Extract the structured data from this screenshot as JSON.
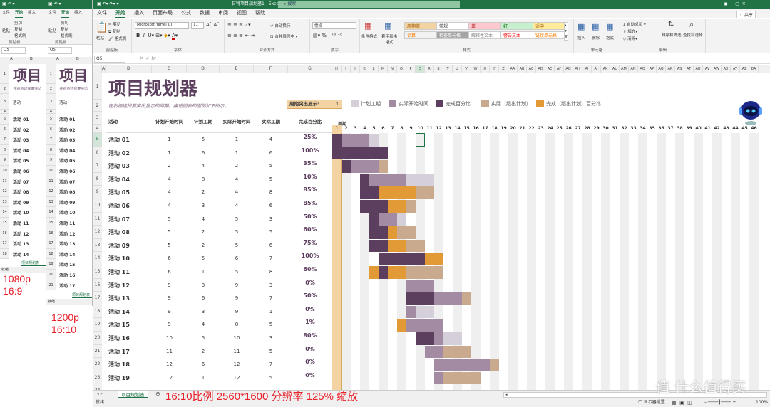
{
  "window": {
    "title": "甘特项目规划器1 - Excel",
    "search": "搜索",
    "share": "共享"
  },
  "tabs": [
    "文件",
    "开始",
    "插入",
    "页面布局",
    "公式",
    "数据",
    "审阅",
    "视图",
    "帮助"
  ],
  "active_tab": "开始",
  "ribbon": {
    "clipboard": {
      "paste": "粘贴",
      "cut": "剪切",
      "copy": "复制",
      "format_painter": "格式刷",
      "label": "剪贴板"
    },
    "font": {
      "name": "Microsoft YaHei UI",
      "size": "11",
      "label": "字体"
    },
    "alignment": {
      "wrap": "自动换行",
      "merge": "合并后居中",
      "label": "对齐方式"
    },
    "number": {
      "format": "常规",
      "label": "数字"
    },
    "styles": {
      "conditional": "条件格式",
      "table": "套用表格格式",
      "label": "样式",
      "cells": [
        {
          "text": "周期值",
          "bg": "#f4d3a3",
          "fg": "#9c5700"
        },
        {
          "text": "常规",
          "bg": "#ffffff",
          "fg": "#333333"
        },
        {
          "text": "差",
          "bg": "#ffc7ce",
          "fg": "#9c0006"
        },
        {
          "text": "好",
          "bg": "#c6efce",
          "fg": "#006100"
        },
        {
          "text": "适中",
          "bg": "#ffeb9c",
          "fg": "#9c5700"
        },
        {
          "text": "计算",
          "bg": "#f2f2f2",
          "fg": "#fa7d00"
        },
        {
          "text": "检查单元格",
          "bg": "#a5a5a5",
          "fg": "#ffffff"
        },
        {
          "text": "解释性文本",
          "bg": "#ffffff",
          "fg": "#7f7f7f"
        },
        {
          "text": "警告文本",
          "bg": "#ffffff",
          "fg": "#ff0000"
        },
        {
          "text": "链接单元格",
          "bg": "#ffffff",
          "fg": "#fa7d00"
        }
      ]
    },
    "cells": {
      "insert": "插入",
      "delete": "删除",
      "format": "格式",
      "label": "单元格"
    },
    "editing": {
      "autosum": "自动求和",
      "fill": "填充",
      "clear": "清除",
      "sort": "排序和筛选",
      "find": "查找和选择",
      "label": "编辑"
    }
  },
  "formula_bar": {
    "name_box": "Q5",
    "fx": "fx"
  },
  "sheet": {
    "title": "项目规划器",
    "subtitle": "在右侧选择要突出显示的周期。描述图表的图例如下所示。",
    "highlight_label": "周期突出显示:",
    "highlight_value": 1,
    "legend": [
      {
        "text": "计划工期",
        "color": "#d5cfd9"
      },
      {
        "text": "实际开始时间",
        "color": "#a38ca3"
      },
      {
        "text": "完成百分比",
        "color": "#5c3f5e"
      },
      {
        "text": "实际（超出计划）",
        "color": "#c9aa8e"
      },
      {
        "text": "完成（超出计划）百分比",
        "color": "#e29a37"
      }
    ],
    "headers": [
      "活动",
      "计划开始时间",
      "计划工期",
      "实际开始时间",
      "实际工期",
      "完成百分比"
    ],
    "period_label": "周期",
    "activities": [
      {
        "name": "活动 01",
        "ps": 1,
        "pd": 5,
        "as": 1,
        "ad": 4,
        "pct": "25%"
      },
      {
        "name": "活动 02",
        "ps": 1,
        "pd": 6,
        "as": 1,
        "ad": 6,
        "pct": "100%"
      },
      {
        "name": "活动 03",
        "ps": 2,
        "pd": 4,
        "as": 2,
        "ad": 5,
        "pct": "35%"
      },
      {
        "name": "活动 04",
        "ps": 4,
        "pd": 8,
        "as": 4,
        "ad": 5,
        "pct": "10%"
      },
      {
        "name": "活动 05",
        "ps": 4,
        "pd": 2,
        "as": 4,
        "ad": 8,
        "pct": "85%"
      },
      {
        "name": "活动 06",
        "ps": 4,
        "pd": 3,
        "as": 4,
        "ad": 6,
        "pct": "85%"
      },
      {
        "name": "活动 07",
        "ps": 5,
        "pd": 4,
        "as": 5,
        "ad": 3,
        "pct": "50%"
      },
      {
        "name": "活动 08",
        "ps": 5,
        "pd": 2,
        "as": 5,
        "ad": 5,
        "pct": "60%"
      },
      {
        "name": "活动 09",
        "ps": 5,
        "pd": 2,
        "as": 5,
        "ad": 6,
        "pct": "75%"
      },
      {
        "name": "活动 10",
        "ps": 6,
        "pd": 5,
        "as": 6,
        "ad": 7,
        "pct": "100%"
      },
      {
        "name": "活动 11",
        "ps": 6,
        "pd": 1,
        "as": 5,
        "ad": 8,
        "pct": "60%"
      },
      {
        "name": "活动 12",
        "ps": 9,
        "pd": 3,
        "as": 9,
        "ad": 3,
        "pct": "0%"
      },
      {
        "name": "活动 13",
        "ps": 9,
        "pd": 6,
        "as": 9,
        "ad": 7,
        "pct": "50%"
      },
      {
        "name": "活动 14",
        "ps": 9,
        "pd": 3,
        "as": 9,
        "ad": 1,
        "pct": "0%"
      },
      {
        "name": "活动 15",
        "ps": 9,
        "pd": 4,
        "as": 8,
        "ad": 5,
        "pct": "1%"
      },
      {
        "name": "活动 16",
        "ps": 10,
        "pd": 5,
        "as": 10,
        "ad": 3,
        "pct": "80%"
      },
      {
        "name": "活动 17",
        "ps": 11,
        "pd": 2,
        "as": 11,
        "ad": 5,
        "pct": "0%"
      },
      {
        "name": "活动 18",
        "ps": 12,
        "pd": 6,
        "as": 12,
        "ad": 7,
        "pct": "0%"
      },
      {
        "name": "活动 19",
        "ps": 12,
        "pd": 1,
        "as": 12,
        "ad": 5,
        "pct": "0%"
      }
    ],
    "colors": {
      "plan": "#d5cfd9",
      "actual": "#a38ca3",
      "complete": "#5c3f5e",
      "beyond": "#c9aa8e",
      "complete_beyond": "#e29a37",
      "highlight": "#f4d3a3",
      "title": "#5c3f5e"
    }
  },
  "sheet_tab": "项目规划表",
  "status": {
    "ready": "就绪",
    "display_settings": "显示器设置",
    "zoom": "100%"
  },
  "annotations": {
    "left1": [
      "1080p",
      "16:9"
    ],
    "left2": [
      "1200p",
      "16:10"
    ],
    "bottom": "16:10比例 2560*1600 分辨率 125% 缩放"
  },
  "watermark": "值 什么值得买",
  "mini": {
    "tabs": [
      "文件",
      "开始",
      "插入"
    ],
    "paste": "粘贴",
    "cut": "剪切",
    "copy": "复制",
    "painter": "格式刷",
    "group": "剪贴板",
    "name_box": "Q5",
    "title": "项目",
    "subtitle": "在右侧选择要突出",
    "header": "活动"
  }
}
